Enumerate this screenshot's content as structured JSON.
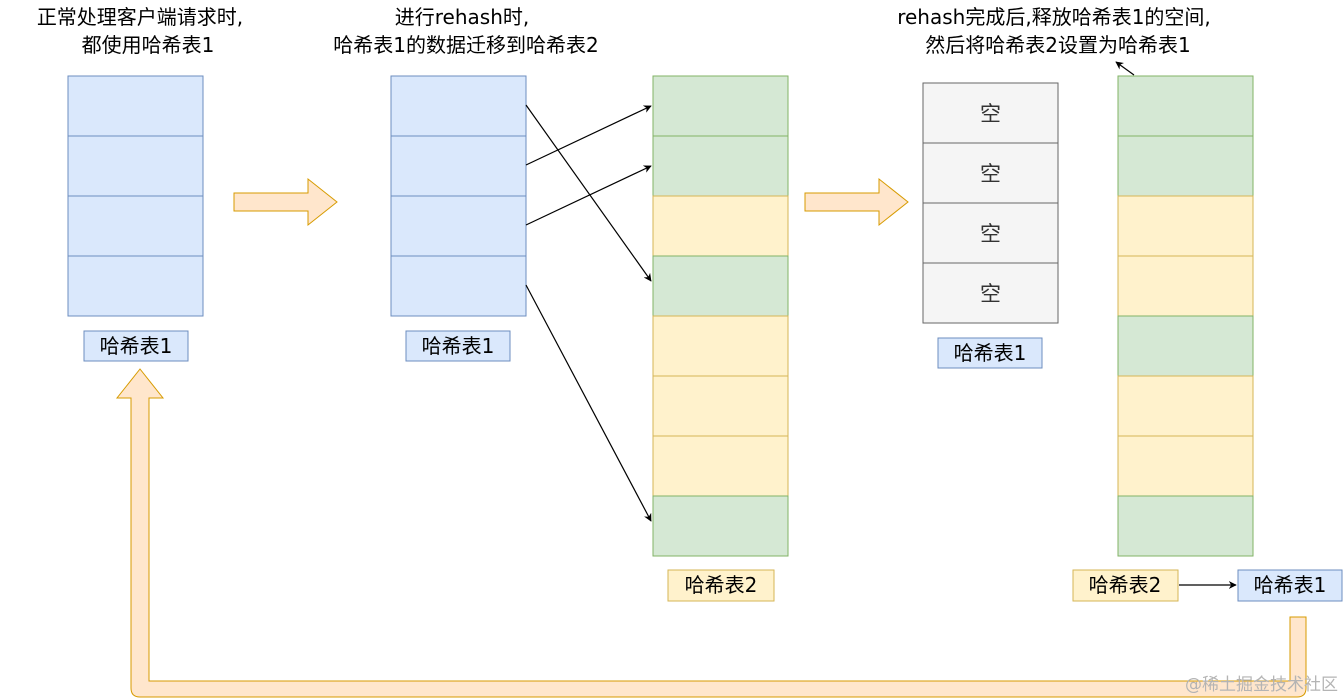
{
  "captions": {
    "normal": [
      "正常处理客户端请求时,",
      "都使用哈希表1"
    ],
    "rehash": [
      "进行rehash时,",
      "哈希表1的数据迁移到哈希表2"
    ],
    "done": [
      "rehash完成后,释放哈希表1的空间,",
      "然后将哈希表2设置为哈希表1"
    ]
  },
  "labels": {
    "t1_normal": "哈希表1",
    "t1_rehash": "哈希表1",
    "t2_rehash": "哈希表2",
    "t1_released": "哈希表1",
    "t2_final": "哈希表2",
    "t2_renamed": "哈希表1"
  },
  "empty_cells": [
    "空",
    "空",
    "空",
    "空"
  ],
  "table2_cells": [
    "green",
    "green",
    "yellow",
    "green",
    "yellow",
    "yellow",
    "yellow",
    "green"
  ],
  "final_cells": [
    "green",
    "green",
    "yellow",
    "yellow",
    "green",
    "yellow",
    "yellow",
    "green"
  ],
  "colors": {
    "blue_fill": "#dae8fc",
    "blue_stroke": "#6c8ebf",
    "green_fill": "#d5e8d4",
    "green_stroke": "#82b366",
    "yellow_fill": "#fff2cc",
    "yellow_stroke": "#d6b656",
    "gray_fill": "#f5f5f5",
    "gray_stroke": "#666666",
    "arrow_fill": "#ffe6cc",
    "arrow_stroke": "#d79b00"
  },
  "watermark": "@稀土掘金技术社区"
}
